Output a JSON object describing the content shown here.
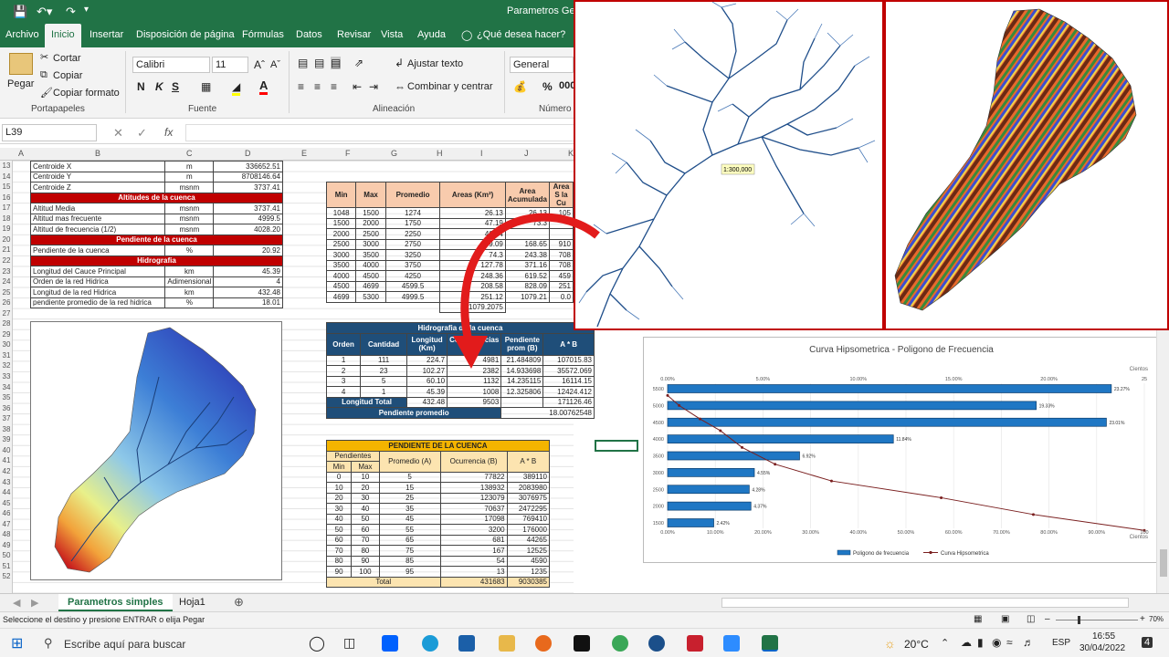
{
  "window": {
    "title": "Parametros Geor"
  },
  "menu": {
    "tabs": [
      "Archivo",
      "Inicio",
      "Insertar",
      "Disposición de página",
      "Fórmulas",
      "Datos",
      "Revisar",
      "Vista",
      "Ayuda"
    ],
    "tell": "¿Qué desea hacer?"
  },
  "ribbon": {
    "paste": "Pegar",
    "cut": "Cortar",
    "copy": "Copiar",
    "format_painter": "Copiar formato",
    "clipboard": "Portapapeles",
    "font_name": "Calibri",
    "font_size": "11",
    "font_group": "Fuente",
    "wrap": "Ajustar texto",
    "merge": "Combinar y centrar",
    "align_group": "Alineación",
    "number_format": "General",
    "number_group": "Número"
  },
  "formula": {
    "namebox": "L39",
    "fx": "fx"
  },
  "columns": [
    "A",
    "B",
    "C",
    "D",
    "E",
    "F",
    "G",
    "H",
    "I",
    "J",
    "K"
  ],
  "rows": [
    13,
    14,
    15,
    16,
    17,
    18,
    19,
    20,
    21,
    22,
    23,
    24,
    25,
    26,
    27,
    28,
    29,
    30,
    31,
    32,
    33,
    34,
    35,
    36,
    37,
    38,
    39,
    40,
    41,
    42,
    43,
    44,
    45,
    46,
    47,
    48,
    49,
    50,
    51,
    52
  ],
  "params": [
    {
      "type": "row",
      "label": "Centroide X",
      "unit": "m",
      "value": "336652.51"
    },
    {
      "type": "row",
      "label": "Centroide Y",
      "unit": "m",
      "value": "8708146.64"
    },
    {
      "type": "row",
      "label": "Centroide Z",
      "unit": "msnm",
      "value": "3737.41"
    },
    {
      "type": "hdr",
      "label": "Altitudes de la cuenca"
    },
    {
      "type": "row",
      "label": "Altitud Media",
      "unit": "msnm",
      "value": "3737.41"
    },
    {
      "type": "row",
      "label": "Altitud mas frecuente",
      "unit": "msnm",
      "value": "4999.5"
    },
    {
      "type": "row",
      "label": "Altitud de frecuencia (1/2)",
      "unit": "msnm",
      "value": "4028.20"
    },
    {
      "type": "hdr",
      "label": "Pendiente de la cuenca"
    },
    {
      "type": "row",
      "label": "Pendiente de la cuenca",
      "unit": "%",
      "value": "20.92"
    },
    {
      "type": "hdr",
      "label": "Hidrografia"
    },
    {
      "type": "row",
      "label": "Longitud del Cauce Principal",
      "unit": "km",
      "value": "45.39"
    },
    {
      "type": "row",
      "label": "Orden de la red Hidrica",
      "unit": "Adimensional",
      "value": "4"
    },
    {
      "type": "row",
      "label": "Longitud de la red Hidrica",
      "unit": "km",
      "value": "432.48"
    },
    {
      "type": "row",
      "label": "pendiente promedio de la red hidrica",
      "unit": "%",
      "value": "18.01"
    }
  ],
  "areas": {
    "headers": [
      "Min",
      "Max",
      "Promedio",
      "Areas (Km²)",
      "Area Acumulada",
      "Area S la Cu"
    ],
    "rows": [
      [
        "1048",
        "1500",
        "1274",
        "26.13",
        "26.13",
        "105"
      ],
      [
        "1500",
        "2000",
        "1750",
        "47.19",
        "73.3",
        ""
      ],
      [
        "2000",
        "2500",
        "2250",
        "46.24",
        "",
        ""
      ],
      [
        "2500",
        "3000",
        "2750",
        "49.09",
        "168.65",
        "910"
      ],
      [
        "3000",
        "3500",
        "3250",
        "74.3",
        "243.38",
        "708"
      ],
      [
        "3500",
        "4000",
        "3750",
        "127.78",
        "371.16",
        "708"
      ],
      [
        "4000",
        "4500",
        "4250",
        "248.36",
        "619.52",
        "459"
      ],
      [
        "4500",
        "4699",
        "4599.5",
        "208.58",
        "828.09",
        "251"
      ],
      [
        "4699",
        "5300",
        "4999.5",
        "251.12",
        "1079.21",
        "0.0"
      ]
    ],
    "total": "1079.2075"
  },
  "hydro": {
    "title": "Hidrografia de la cuenca",
    "headers": [
      "Orden",
      "Cantidad",
      "Longitud (Km)",
      "Coincidencias (A)",
      "Pendiente prom (B)",
      "A * B"
    ],
    "rows": [
      [
        "1",
        "111",
        "224.7",
        "4981",
        "21.484809",
        "107015.83"
      ],
      [
        "2",
        "23",
        "102.27",
        "2382",
        "14.933698",
        "35572.069"
      ],
      [
        "3",
        "5",
        "60.10",
        "1132",
        "14.235115",
        "16114.15"
      ],
      [
        "4",
        "1",
        "45.39",
        "1008",
        "12.325806",
        "12424.412"
      ]
    ],
    "total_label": "Longitud Total",
    "total_len": "432.48",
    "total_coin": "9503",
    "total_ab": "171126.46",
    "avg_label": "Pendiente promedio",
    "avg": "18.00762548"
  },
  "slope": {
    "title": "PENDIENTE DE LA CUENCA",
    "h_pend": "Pendientes",
    "h_prom": "Promedio (A)",
    "h_occ": "Ocurrencia (B)",
    "h_ab": "A * B",
    "h_min": "Min",
    "h_max": "Max",
    "rows": [
      [
        "0",
        "10",
        "5",
        "77822",
        "389110"
      ],
      [
        "10",
        "20",
        "15",
        "138932",
        "2083980"
      ],
      [
        "20",
        "30",
        "25",
        "123079",
        "3076975"
      ],
      [
        "30",
        "40",
        "35",
        "70637",
        "2472295"
      ],
      [
        "40",
        "50",
        "45",
        "17098",
        "769410"
      ],
      [
        "50",
        "60",
        "55",
        "3200",
        "176000"
      ],
      [
        "60",
        "70",
        "65",
        "681",
        "44265"
      ],
      [
        "70",
        "80",
        "75",
        "167",
        "12525"
      ],
      [
        "80",
        "90",
        "85",
        "54",
        "4590"
      ],
      [
        "90",
        "100",
        "95",
        "13",
        "1235"
      ]
    ],
    "total_label": "Total",
    "total_occ": "431683",
    "total_ab": "9030385"
  },
  "network": {
    "scale": "1:300,000"
  },
  "chart_data": {
    "type": "bar",
    "title": "Curva Hipsometrica - Poligono de Frecuencia",
    "categories": [
      "1500",
      "2000",
      "2500",
      "3000",
      "3500",
      "4000",
      "4500",
      "5000",
      "5500"
    ],
    "series": [
      {
        "name": "Poligono de frecuencia",
        "values": [
          2.42,
          4.37,
          4.28,
          4.55,
          6.92,
          11.84,
          23.01,
          19.33,
          23.27
        ],
        "labels": [
          "2.42%",
          "4.37%",
          "4.28%",
          "4.55%",
          "6.92%",
          "11.84%",
          "23.01%",
          "19.33%",
          "23.27%"
        ]
      },
      {
        "name": "Curva Hipsometrica",
        "x": [
          0,
          2.42,
          6.79,
          11.07,
          15.62,
          22.54,
          34.38,
          57.39,
          76.72,
          100
        ],
        "y": [
          5300,
          4999.5,
          4599.5,
          4250,
          3750,
          3250,
          2750,
          2250,
          1750,
          1274
        ]
      }
    ],
    "top_ticks": [
      "0.00%",
      "5.00%",
      "10.00%",
      "15.00%",
      "20.00%",
      "25"
    ],
    "top_label": "Cientos",
    "bottom_ticks": [
      "0.00%",
      "10.00%",
      "20.00%",
      "30.00%",
      "40.00%",
      "50.00%",
      "60.00%",
      "70.00%",
      "80.00%",
      "90.00%",
      "100"
    ],
    "bottom_label": "Cientos",
    "y_ticks": [
      "1500",
      "2000",
      "2500",
      "3000",
      "3500",
      "4000",
      "4500",
      "5000",
      "5500"
    ],
    "xlim_top": [
      0,
      25
    ],
    "xlim_bottom": [
      0,
      100
    ],
    "ylim": [
      1274,
      5500
    ],
    "legend": "bottom"
  },
  "sheets": {
    "active": "Parametros simples",
    "other": "Hoja1"
  },
  "status": {
    "message": "Seleccione el destino y presione ENTRAR o elija Pegar",
    "zoom": "70%"
  },
  "taskbar": {
    "search": "Escribe aquí para buscar",
    "temp": "20°C",
    "lang": "ESP",
    "time": "16:55",
    "date": "30/04/2022",
    "badge": "4"
  }
}
